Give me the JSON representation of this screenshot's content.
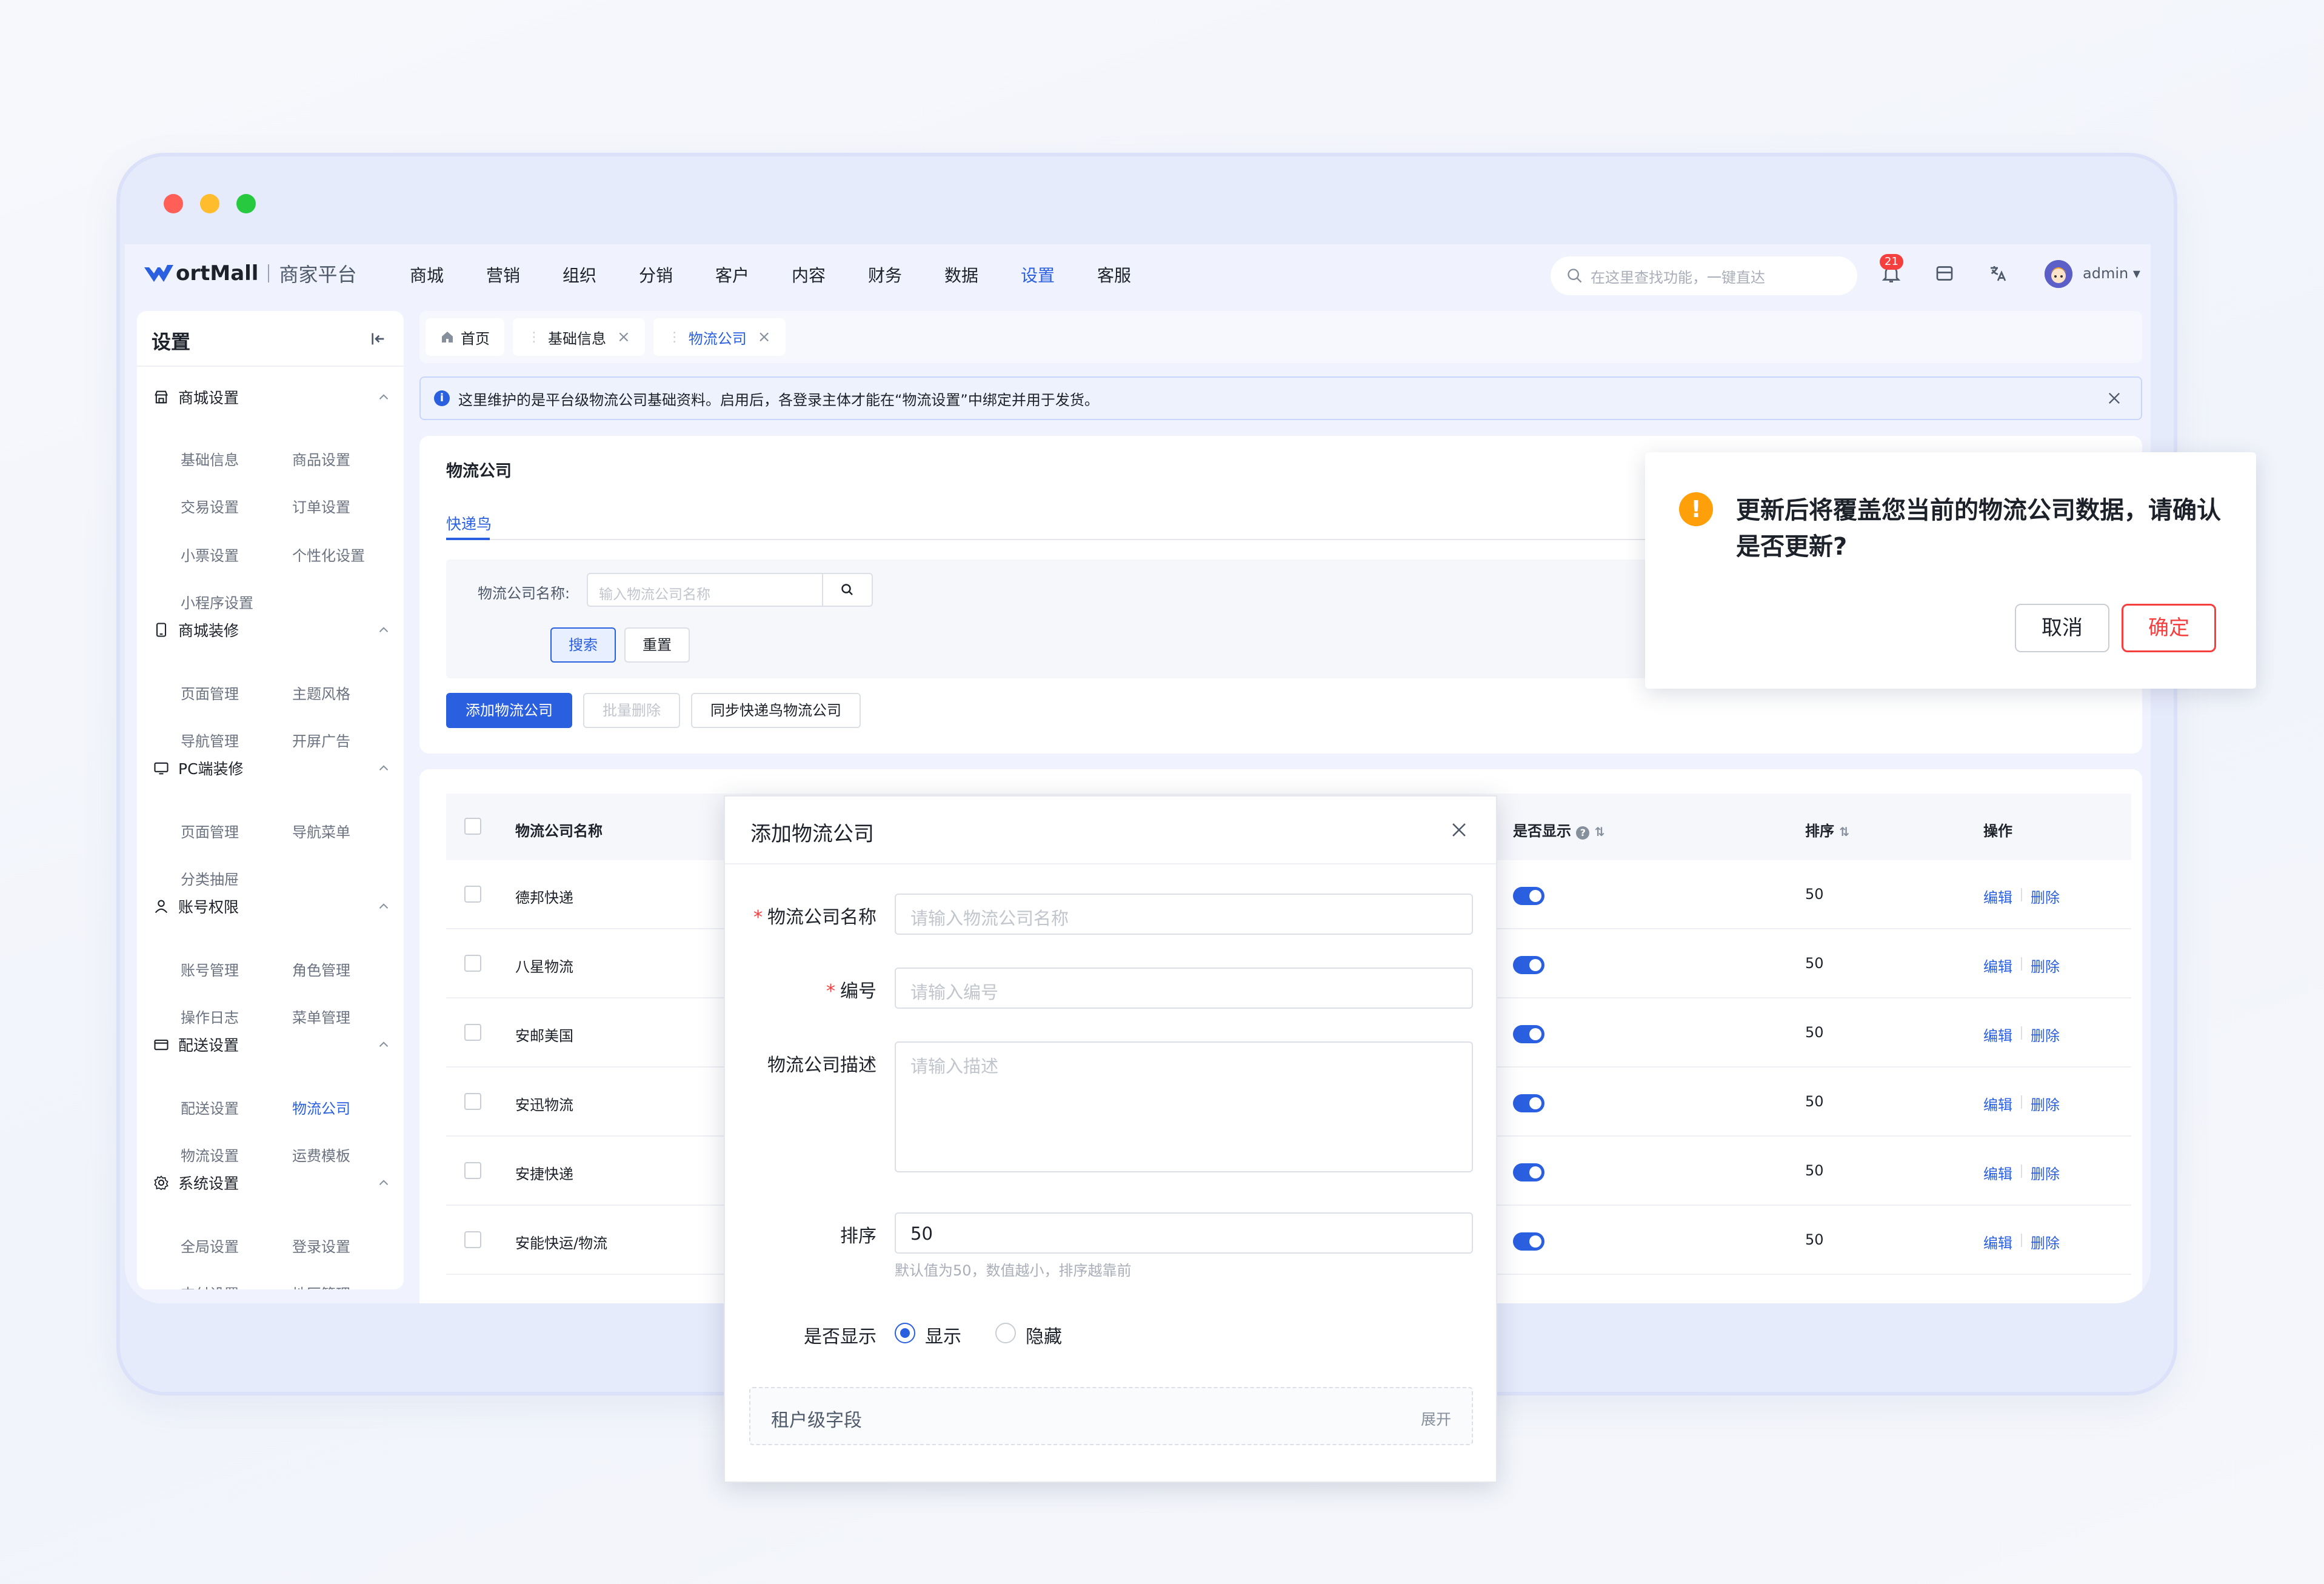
{
  "app": {
    "brand": "ortMall",
    "platform": "商家平台",
    "colors": {
      "accent": "#2a5fe0",
      "danger": "#f53f3f",
      "warning": "#ff9f0a"
    }
  },
  "nav": {
    "items": [
      "商城",
      "营销",
      "组织",
      "分销",
      "客户",
      "内容",
      "财务",
      "数据",
      "设置",
      "客服"
    ],
    "active": "设置",
    "search_placeholder": "在这里查找功能，一键直达",
    "notification_count": "21",
    "user": "admin",
    "icons": [
      "bell-icon",
      "store-icon",
      "translate-icon",
      "avatar"
    ]
  },
  "sidebar": {
    "title": "设置",
    "groups": [
      {
        "label": "商城设置",
        "icon": "shop-icon",
        "items": [
          "基础信息",
          "商品设置",
          "交易设置",
          "订单设置",
          "小票设置",
          "个性化设置",
          "小程序设置"
        ]
      },
      {
        "label": "商城装修",
        "icon": "tablet-icon",
        "items": [
          "页面管理",
          "主题风格",
          "导航管理",
          "开屏广告"
        ]
      },
      {
        "label": "PC端装修",
        "icon": "monitor-icon",
        "items": [
          "页面管理",
          "导航菜单",
          "分类抽屉"
        ]
      },
      {
        "label": "账号权限",
        "icon": "user-icon",
        "items": [
          "账号管理",
          "角色管理",
          "操作日志",
          "菜单管理"
        ]
      },
      {
        "label": "配送设置",
        "icon": "truck-icon",
        "items": [
          "配送设置",
          "物流公司",
          "物流设置",
          "运费模板"
        ]
      },
      {
        "label": "系统设置",
        "icon": "gear-icon",
        "items": [
          "全局设置",
          "登录设置",
          "支付设置",
          "地区管理"
        ]
      }
    ],
    "active_item": "物流公司"
  },
  "tabs": [
    {
      "label": "首页",
      "closable": false
    },
    {
      "label": "基础信息",
      "closable": true
    },
    {
      "label": "物流公司",
      "closable": true,
      "active": true
    }
  ],
  "alert": {
    "text": "这里维护的是平台级物流公司基础资料。启用后，各登录主体才能在“物流设置”中绑定并用于发货。"
  },
  "page": {
    "title": "物流公司",
    "subtab": "快递鸟",
    "filter": {
      "label": "物流公司名称:",
      "placeholder": "输入物流公司名称",
      "search_button": "搜索",
      "reset_button": "重置"
    },
    "actions": {
      "add": "添加物流公司",
      "batch_delete": "批量删除",
      "sync": "同步快递鸟物流公司"
    }
  },
  "table": {
    "columns": {
      "name": "物流公司名称",
      "visible": "是否显示",
      "sort": "排序",
      "ops": "操作"
    },
    "rows": [
      {
        "name": "德邦快递",
        "sort": "50",
        "edit": "编辑",
        "delete": "删除"
      },
      {
        "name": "八星物流",
        "sort": "50",
        "edit": "编辑",
        "delete": "删除"
      },
      {
        "name": "安邮美国",
        "sort": "50",
        "edit": "编辑",
        "delete": "删除"
      },
      {
        "name": "安迅物流",
        "sort": "50",
        "edit": "编辑",
        "delete": "删除"
      },
      {
        "name": "安捷快递",
        "sort": "50",
        "edit": "编辑",
        "delete": "删除"
      },
      {
        "name": "安能快运/物流",
        "sort": "50",
        "edit": "编辑",
        "delete": "删除"
      }
    ]
  },
  "modal": {
    "title": "添加物流公司",
    "fields": {
      "name_label": "物流公司名称",
      "name_placeholder": "请输入物流公司名称",
      "code_label": "编号",
      "code_placeholder": "请输入编号",
      "desc_label": "物流公司描述",
      "desc_placeholder": "请输入描述",
      "sort_label": "排序",
      "sort_value": "50",
      "sort_hint": "默认值为50，数值越小，排序越靠前",
      "visible_label": "是否显示",
      "visible_on": "显示",
      "visible_off": "隐藏"
    },
    "tenant": {
      "label": "租户级字段",
      "expand": "展开"
    }
  },
  "popconfirm": {
    "message": "更新后将覆盖您当前的物流公司数据，请确认是否更新?",
    "cancel": "取消",
    "ok": "确定"
  }
}
